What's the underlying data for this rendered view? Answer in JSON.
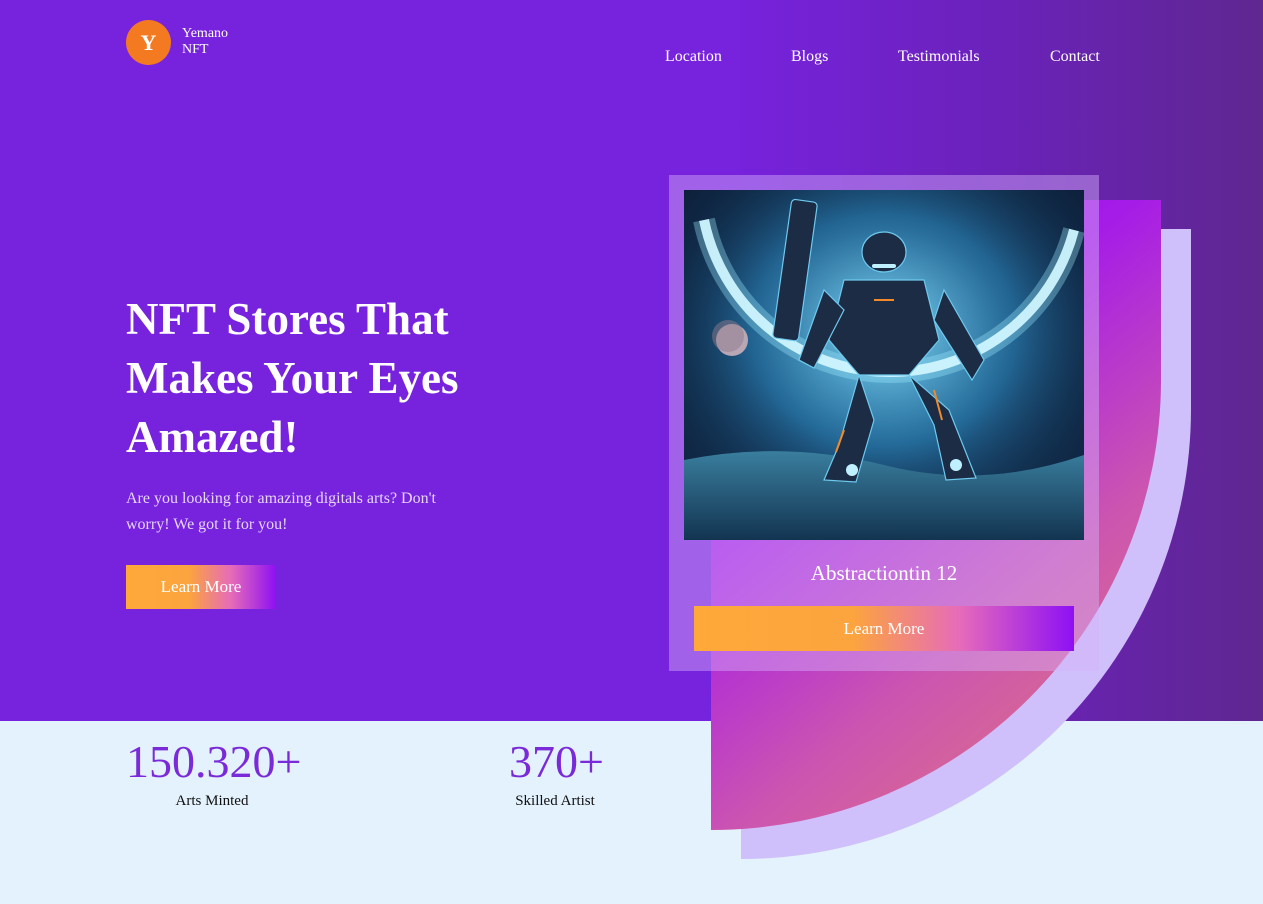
{
  "brand": {
    "initial": "Y",
    "name_line1": "Yemano",
    "name_line2": "NFT"
  },
  "nav": {
    "items": [
      "Location",
      "Blogs",
      "Testimonials",
      "Contact"
    ]
  },
  "hero": {
    "headline": "NFT Stores That Makes Your Eyes Amazed!",
    "subtitle": "Are you looking for amazing digitals arts? Don't worry! We got it for you!",
    "cta_label": "Learn More"
  },
  "card": {
    "title": "Abstractiontin 12",
    "cta_label": "Learn More"
  },
  "stats": [
    {
      "value": "150.320+",
      "label": "Arts Minted"
    },
    {
      "value": "370+",
      "label": "Skilled Artist"
    }
  ],
  "colors": {
    "hero_bg": "#7722dd",
    "logo_orange": "#f47a21",
    "cta_start": "#fea93a",
    "cta_end": "#8e10f4",
    "stat_purple": "#7a2ad8",
    "stats_bg": "#e3f2fc"
  }
}
